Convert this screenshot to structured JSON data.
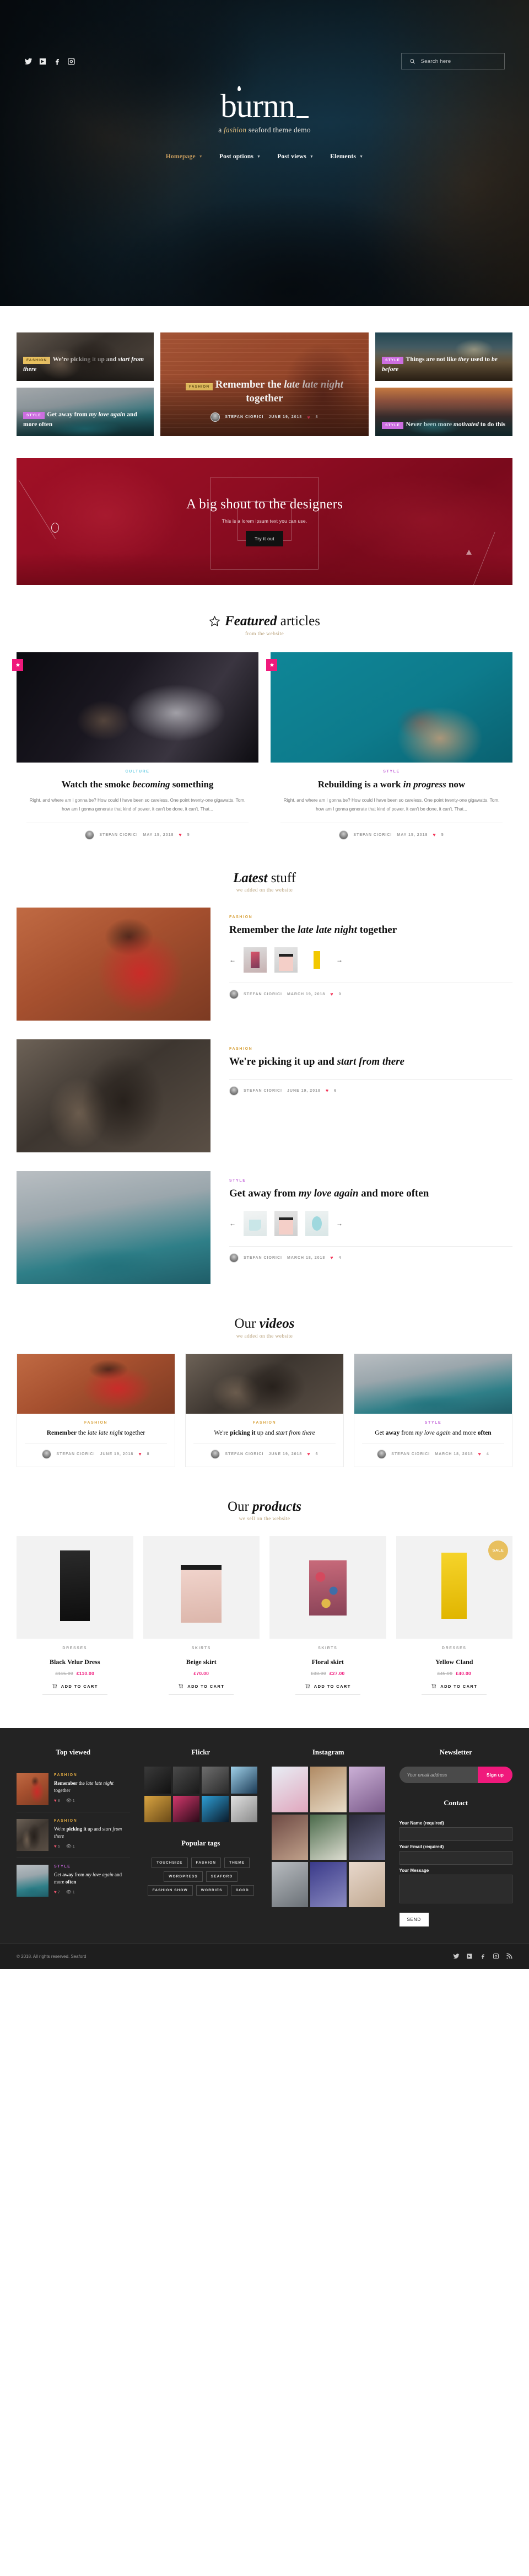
{
  "header": {
    "brand": "burnn",
    "tagline_a": "a ",
    "tagline_fashion": "fashion",
    "tagline_rest": " seaford theme demo",
    "search_placeholder": "Search here",
    "social": [
      "twitter-icon",
      "vimeo-icon",
      "facebook-icon",
      "instagram-icon"
    ],
    "nav": [
      {
        "label": "Homepage",
        "active": true
      },
      {
        "label": "Post options",
        "active": false
      },
      {
        "label": "Post views",
        "active": false
      },
      {
        "label": "Elements",
        "active": false
      }
    ]
  },
  "mosaic": {
    "tiles": [
      {
        "badge": "FASHION",
        "badge_kind": "fashion",
        "title_a": "We're ",
        "title_b": "picking it",
        "title_c": " up and ",
        "title_d": "start from there"
      },
      {
        "badge": "STYLE",
        "badge_kind": "style",
        "title_a": "Get ",
        "title_b": "away",
        "title_c": " from ",
        "title_d": "my love again",
        "title_e": " and more ",
        "title_f": "often"
      },
      {
        "badge": "STYLE",
        "badge_kind": "style",
        "title_a": "Things ",
        "title_b": "are not",
        "title_c": " like ",
        "title_d": "they",
        "title_e": " used to ",
        "title_f": "be before"
      },
      {
        "badge": "STYLE",
        "badge_kind": "style",
        "title_a": "",
        "title_b": "Never",
        "title_c": " been more ",
        "title_d": "motivated",
        "title_e": " to do this",
        "title_f": ""
      }
    ],
    "hero_tile": {
      "badge": "FASHION",
      "title_b": "Remember",
      "title_c": " the ",
      "title_d": "late late night",
      "title_e": " together",
      "author": "STEFAN CIORICI",
      "date": "JUNE 19, 2018",
      "likes": "8"
    }
  },
  "promo": {
    "title": "A big shout to the designers",
    "subtitle": "This is a lorem ipsum text you can use.",
    "button": "Try it out"
  },
  "featured": {
    "title_i": "Featured",
    "title_rest": " articles",
    "subtitle": "from the website",
    "cards": [
      {
        "category": "CULTURE",
        "cat_kind": "culture",
        "title_b": "Watch",
        "title_c": " the smoke ",
        "title_d": "becoming",
        "title_e": " something",
        "excerpt": "Right, and where am I gonna be? How could I have been so careless. One point twenty-one gigawatts. Tom, how am I gonna generate that kind of power, it can't be done, it can't. That...",
        "author": "STEFAN CIORICI",
        "date": "MAY 15, 2018",
        "likes": "5"
      },
      {
        "category": "STYLE",
        "cat_kind": "style",
        "title_b": "Rebuilding",
        "title_c": " is a work ",
        "title_d": "in progress",
        "title_e": " now",
        "excerpt": "Right, and where am I gonna be? How could I have been so careless. One point twenty-one gigawatts. Tom, how am I gonna generate that kind of power, it can't be done, it can't. That...",
        "author": "STEFAN CIORICI",
        "date": "MAY 15, 2018",
        "likes": "5"
      }
    ]
  },
  "latest": {
    "title_i": "Latest",
    "title_rest": " stuff",
    "subtitle": "we added on the website",
    "posts": [
      {
        "category": "FASHION",
        "cat_kind": "fashion",
        "title_b": "Remember",
        "title_c": " the ",
        "title_d": "late late night",
        "title_e": " together",
        "author": "STEFAN CIORICI",
        "date": "MARCH 19, 2018",
        "likes": "0",
        "has_products": true
      },
      {
        "category": "FASHION",
        "cat_kind": "fashion",
        "title_b": "We're ",
        "title_c": "picking it",
        "title_d": " up and ",
        "title_e": "start from there",
        "author": "STEFAN CIORICI",
        "date": "JUNE 19, 2018",
        "likes": "6",
        "has_products": false
      },
      {
        "category": "STYLE",
        "cat_kind": "style",
        "title_b": "Get ",
        "title_c": "away",
        "title_d": " from ",
        "title_e": "my love again",
        "title_f": " and more ",
        "title_g": "often",
        "author": "STEFAN CIORICI",
        "date": "MARCH 18, 2018",
        "likes": "4",
        "has_products": true
      }
    ]
  },
  "videos": {
    "title_rest": "Our ",
    "title_i": "videos",
    "subtitle": "we added on the website",
    "cards": [
      {
        "category": "FASHION",
        "cat_kind": "fashion",
        "title_b": "Remember",
        "title_c": " the ",
        "title_d": "late late night",
        "title_e": " together",
        "author": "STEFAN CIORICI",
        "date": "JUNE 19, 2018",
        "likes": "8"
      },
      {
        "category": "FASHION",
        "cat_kind": "fashion",
        "title_b": "We're ",
        "title_c": "picking it",
        "title_d": " up and ",
        "title_e": "start from there",
        "author": "STEFAN CIORICI",
        "date": "JUNE 19, 2018",
        "likes": "6"
      },
      {
        "category": "STYLE",
        "cat_kind": "style",
        "title_b": "Get ",
        "title_c": "away",
        "title_d": " from ",
        "title_e": "my love again",
        "title_f": " and more ",
        "title_g": "often",
        "author": "STEFAN CIORICI",
        "date": "MARCH 18, 2018",
        "likes": "4"
      }
    ]
  },
  "products": {
    "title_rest": "Our ",
    "title_i": "products",
    "subtitle": "we sell on the website",
    "cart_label": "ADD TO CART",
    "sale_label": "SALE",
    "items": [
      {
        "category": "DRESSES",
        "name": "Black Velur Dress",
        "old_price": "£115.00",
        "price": "£110.00",
        "sale": false
      },
      {
        "category": "SKIRTS",
        "name": "Beige skirt",
        "old_price": "",
        "price": "£70.00",
        "sale": false
      },
      {
        "category": "SKIRTS",
        "name": "Floral skirt",
        "old_price": "£33.00",
        "price": "£27.00",
        "sale": false
      },
      {
        "category": "DRESSES",
        "name": "Yellow Cland",
        "old_price": "£45.00",
        "price": "£40.00",
        "sale": true
      }
    ]
  },
  "footer": {
    "topviewed_title": "Top viewed",
    "flickr_title": "Flickr",
    "tags_title": "Popular tags",
    "instagram_title": "Instagram",
    "newsletter_title": "Newsletter",
    "contact_title": "Contact",
    "newsletter_placeholder": "Your email address",
    "signup_label": "Sign up",
    "name_label": "Your Name (required)",
    "email_label": "Your Email (required)",
    "message_label": "Your Message",
    "send_label": "SEND",
    "copyright": "© 2018. All rights reserved. Seaford",
    "social": [
      "twitter-icon",
      "vimeo-icon",
      "facebook-icon",
      "instagram-icon",
      "rss-icon"
    ],
    "topviewed": [
      {
        "category": "FASHION",
        "cat_kind": "fashion",
        "title_b": "Remember",
        "title_c": " the ",
        "title_d": "late late night",
        "title_e": " together",
        "likes": "8",
        "views": "1"
      },
      {
        "category": "FASHION",
        "cat_kind": "fashion",
        "title_b": "We're ",
        "title_c": "picking it",
        "title_d": " up and ",
        "title_e": "start from there",
        "likes": "6",
        "views": "1"
      },
      {
        "category": "STYLE",
        "cat_kind": "style",
        "title_b": "Get ",
        "title_c": "away",
        "title_d": " from ",
        "title_e": "my love again",
        "title_f": " and more ",
        "title_g": "often",
        "likes": "7",
        "views": "1"
      }
    ],
    "tags": [
      "TOUCHSIZE",
      "FASHION",
      "THEME",
      "WORDPRESS",
      "SEAFORD",
      "FASHION SHOW",
      "WORRIES",
      "GOOD"
    ]
  },
  "colors": {
    "accent_pink": "#f0197c",
    "accent_gold": "#c49a5d",
    "promo_red": "#8e0d22",
    "footer_bg": "#232323"
  }
}
